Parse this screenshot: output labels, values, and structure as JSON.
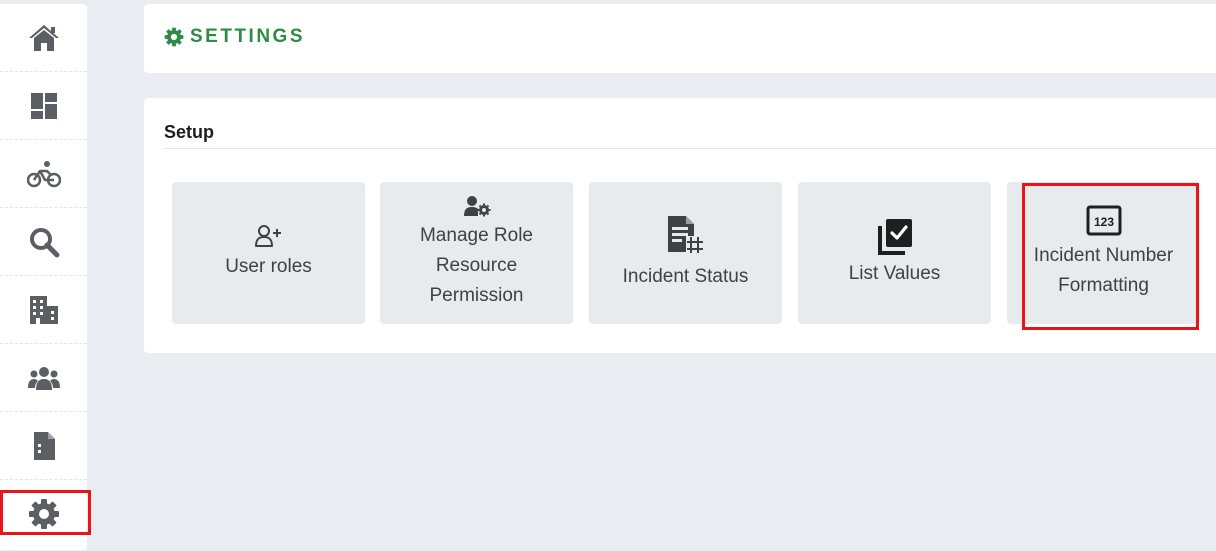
{
  "sidebar": {
    "items": [
      {
        "icon": "home-icon"
      },
      {
        "icon": "dashboard-icon"
      },
      {
        "icon": "bicycle-icon"
      },
      {
        "icon": "search-icon"
      },
      {
        "icon": "building-icon"
      },
      {
        "icon": "users-icon"
      },
      {
        "icon": "file-icon"
      },
      {
        "icon": "gear-icon",
        "highlighted": true
      }
    ]
  },
  "header": {
    "title": "SETTINGS",
    "accent_color": "#2e8b45"
  },
  "setup": {
    "title": "Setup",
    "tiles": [
      {
        "label": "User roles",
        "icon": "user-plus-icon"
      },
      {
        "label": "Manage Role Resource Permission",
        "icon": "user-gear-icon"
      },
      {
        "label": "Incident Status",
        "icon": "document-grid-icon"
      },
      {
        "label": "List Values",
        "icon": "checklist-icon"
      },
      {
        "label": "Incident Number Formatting",
        "icon": "numbers-123-icon",
        "icon_text": "123",
        "highlighted": true
      }
    ]
  },
  "highlight_color": "#e8141a"
}
